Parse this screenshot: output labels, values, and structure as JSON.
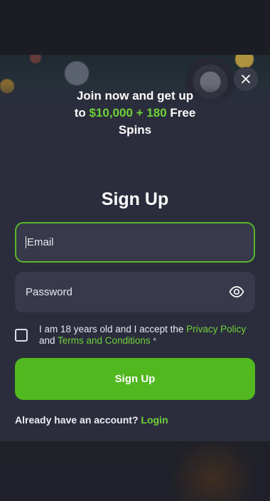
{
  "promo": {
    "line1": "Join now and get up",
    "line2_prefix": "to ",
    "highlight": "$10,000 + 180",
    "line2_suffix": " Free",
    "line3": "Spins"
  },
  "form": {
    "title": "Sign Up",
    "email_placeholder": "Email",
    "password_placeholder": "Password",
    "consent_text": "I am 18 years old and I accept the ",
    "privacy_link": "Privacy Policy",
    "consent_and": " and ",
    "terms_link": "Terms and Conditions",
    "required_mark": "*",
    "submit_label": "Sign Up",
    "login_prompt": "Already have an account?",
    "login_link": "Login",
    "age_checked": false
  },
  "icons": {
    "close": "close-icon",
    "eye": "eye-icon"
  },
  "colors": {
    "accent": "#6fd23a",
    "button": "#52b820",
    "modal_bg": "#2b2d3c",
    "field_bg": "#383a4c"
  }
}
